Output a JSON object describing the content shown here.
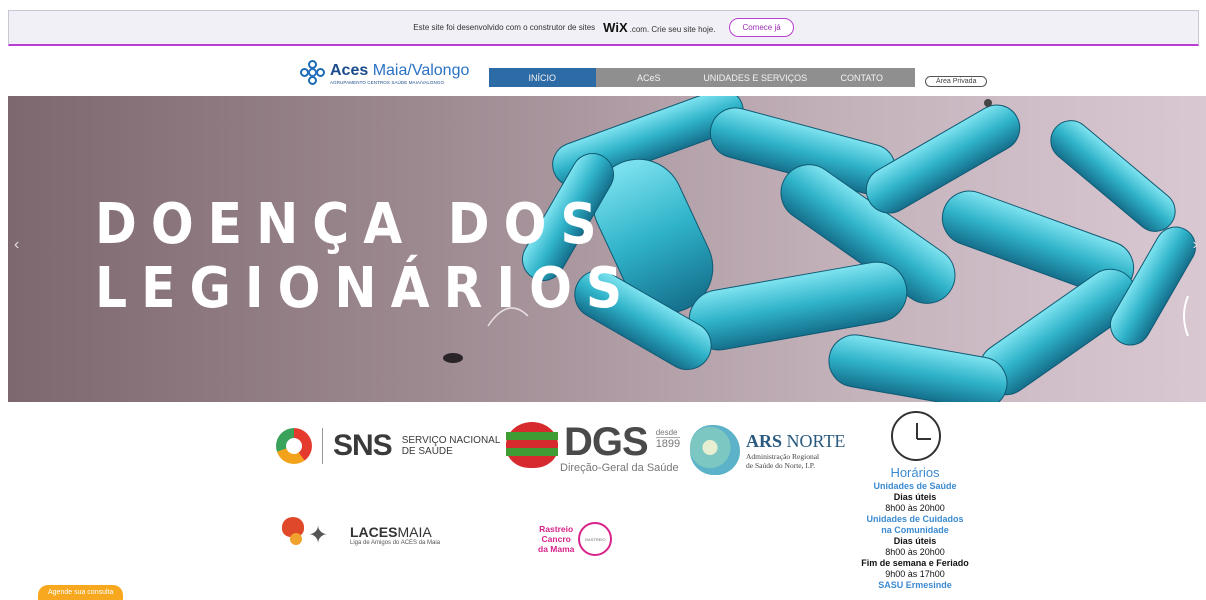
{
  "wix_banner": {
    "text": "Este site foi desenvolvido com o construtor de sites",
    "brand": "WiX",
    "brand_suffix": ".com. Crie seu site hoje.",
    "cta": "Comece já"
  },
  "header": {
    "logo_title": "Aces",
    "logo_title_rest": "Maia/Valongo",
    "logo_subtitle": "AGRUPAMENTO CENTROS SAÚDE MAIA/VALONGO",
    "nav": [
      "INÍCIO",
      "ACeS",
      "UNIDADES E SERVIÇOS",
      "CONTATO"
    ],
    "area_privada": "Área Privada"
  },
  "hero": {
    "line1": "DOENÇA DOS",
    "line2": "LEGIONÁRIOS",
    "prev_arrow": "‹",
    "next_arrow": "›"
  },
  "partners": {
    "sns_short": "SNS",
    "sns_line1": "SERVIÇO NACIONAL",
    "sns_line2": "DE SAÚDE",
    "dgs_short": "DGS",
    "dgs_desde": "desde",
    "dgs_year": "1899",
    "dgs_name": "Direção-Geral da Saúde",
    "ars_name_bold": "ARS",
    "ars_name_rest": " NORTE",
    "ars_sub1": "Administração Regional",
    "ars_sub2": "de Saúde do Norte, I.P.",
    "laces_bold": "LACES",
    "laces_rest": "MAIA",
    "laces_sub": "Liga de Amigos do ACES da Maia",
    "rastreio_l1": "Rastreio",
    "rastreio_l2": "Cancro",
    "rastreio_l3": "da Mama",
    "rastreio_badge": "RASTREIO"
  },
  "horarios": {
    "title": "Horários",
    "section1": "Unidades de Saúde",
    "s1_days": "Dias úteis",
    "s1_hours": "8h00 às 20h00",
    "section2_l1": "Unidades de Cuidados",
    "section2_l2": "na Comunidade",
    "s2_days": "Dias úteis",
    "s2_hours": "8h00 às 20h00",
    "s2_weekend": "Fim de semana e Feriado",
    "s2_weekend_hours": "9h00 às 17h00",
    "section3": "SASU Ermesinde"
  },
  "agende": "Agende sua consulta",
  "colors": {
    "accent": "#b83fd1",
    "nav_active": "#2d6ba6",
    "nav_bg": "#8f8f8f",
    "link_blue": "#3a8ad1",
    "agende": "#f7a81f"
  }
}
